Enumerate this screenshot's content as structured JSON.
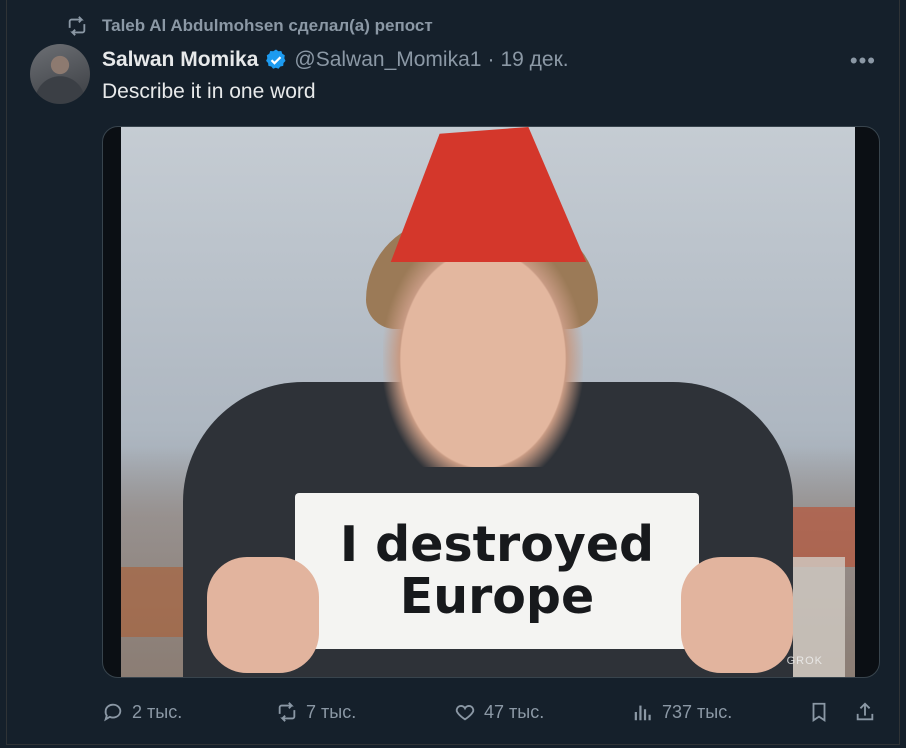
{
  "repost_banner": {
    "text": "Taleb Al Abdulmohsen сделал(а) репост",
    "icon": "repost-icon"
  },
  "tweet": {
    "author_name": "Salwan Momika",
    "handle": "@Salwan_Momika1",
    "separator": "·",
    "date": "19 дек.",
    "text": "Describe it in one word",
    "more_icon": "more-icon"
  },
  "media": {
    "sign_line1": "I destroyed",
    "sign_line2": "Europe",
    "watermark": "GROK"
  },
  "actions": {
    "replies": "2 тыс.",
    "reposts": "7 тыс.",
    "likes": "47 тыс.",
    "views": "737 тыс."
  },
  "colors": {
    "background": "#15202b",
    "secondary_text": "#8b98a5",
    "verified": "#1d9bf0",
    "hat": "#d4372b"
  }
}
